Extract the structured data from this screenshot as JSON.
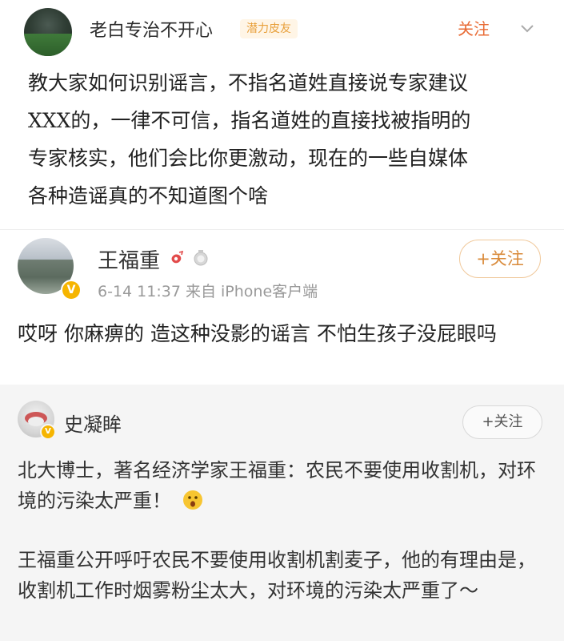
{
  "post1": {
    "username": "老白专治不开心",
    "badge": "潜力皮友",
    "follow_label": "关注",
    "text": "教大家如何识别谣言，不指名道姓直接说专家建议\nXXX的，一律不可信，指名道姓的直接找被指明的\n专家核实，他们会比你更激动，现在的一些自媒体\n各种造谣真的不知道图个啥"
  },
  "post2": {
    "username": "王福重",
    "meta": "6-14 11:37  来自 iPhone客户端",
    "follow_label": "+关注",
    "text": "哎呀 你麻痹的 造这种没影的谣言  不怕生孩子没屁眼吗"
  },
  "post3": {
    "username": "史凝眸",
    "follow_label": "+关注",
    "paragraph1": "北大博士，著名经济学家王福重：农民不要使用收割机，对环境的污染太严重！",
    "paragraph2": "王福重公开呼吁农民不要使用收割机割麦子，他的有理由是，收割机工作时烟雾粉尘太大，对环境的污染太严重了～"
  },
  "colors": {
    "follow_orange": "#e86b35",
    "badge_text": "#e8a03b",
    "verified_yellow": "#f6b500",
    "card_gray": "#f5f5f5"
  },
  "icons": [
    "chevron-down-icon",
    "weibo-badge-icon",
    "medal-icon",
    "verified-icon",
    "surprised-emoji-icon"
  ]
}
